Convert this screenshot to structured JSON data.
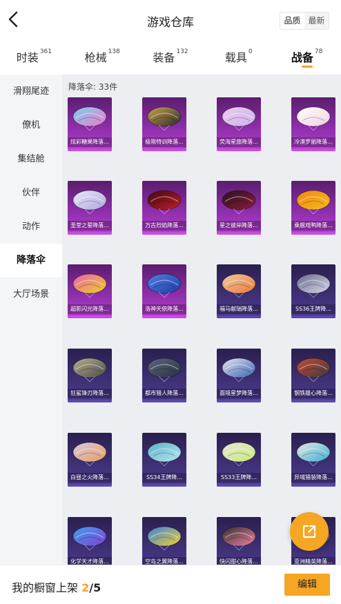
{
  "header": {
    "title": "游戏仓库",
    "sort_options": [
      "品质",
      "最新"
    ],
    "active_sort": 0
  },
  "tabs": [
    {
      "label": "时装",
      "count": "361"
    },
    {
      "label": "枪械",
      "count": "138"
    },
    {
      "label": "装备",
      "count": "132"
    },
    {
      "label": "载具",
      "count": "0"
    },
    {
      "label": "战备",
      "count": "78"
    }
  ],
  "active_tab": 4,
  "sidebar": {
    "items": [
      {
        "label": "滑翔尾迹"
      },
      {
        "label": "僚机"
      },
      {
        "label": "集结舱"
      },
      {
        "label": "伙伴"
      },
      {
        "label": "动作"
      },
      {
        "label": "降落伞"
      },
      {
        "label": "大厅场景"
      }
    ],
    "active_index": 5
  },
  "content": {
    "count_label": "降落伞: 33件",
    "items": [
      {
        "name": "炫彩糖果降落...",
        "tier": "purple",
        "icon": "parachute-icon",
        "colors": [
          "#f07ac8",
          "#7ad0f0"
        ]
      },
      {
        "name": "极限特训降落...",
        "tier": "purple",
        "icon": "parachute-icon",
        "colors": [
          "#2a2a2a",
          "#c9a24a"
        ]
      },
      {
        "name": "荧海星旅降落...",
        "tier": "purple",
        "icon": "parachute-icon",
        "colors": [
          "#c8b6f0",
          "#f0c8e8"
        ]
      },
      {
        "name": "冷漠罗丽降落...",
        "tier": "purple",
        "icon": "parachute-icon",
        "colors": [
          "#f0d0e0",
          "#ffffff"
        ]
      },
      {
        "name": "圣堂之誓降落...",
        "tier": "purple",
        "icon": "parachute-icon",
        "colors": [
          "#b0a8e0",
          "#e8e8f8"
        ]
      },
      {
        "name": "万古烈焰降落...",
        "tier": "purple",
        "icon": "parachute-icon",
        "colors": [
          "#c81e28",
          "#3a0a10"
        ]
      },
      {
        "name": "星之彼岸降落...",
        "tier": "purple",
        "icon": "parachute-icon",
        "colors": [
          "#8a1e3a",
          "#2a1020"
        ]
      },
      {
        "name": "乘舰戏鸭降落...",
        "tier": "purple",
        "icon": "parachute-icon",
        "colors": [
          "#f5b820",
          "#f08a10"
        ]
      },
      {
        "name": "超影闪光降落...",
        "tier": "purple",
        "icon": "parachute-icon",
        "colors": [
          "#f0d020",
          "#e860b0"
        ]
      },
      {
        "name": "洛神天依降落...",
        "tier": "purple",
        "icon": "parachute-icon",
        "colors": [
          "#1e3aa8",
          "#5080e0"
        ]
      },
      {
        "name": "福马献瑞降落...",
        "tier": "blue",
        "icon": "parachute-icon",
        "colors": [
          "#e87a3a",
          "#f0c8a0"
        ]
      },
      {
        "name": "SS36王牌降...",
        "tier": "blue",
        "icon": "parachute-icon",
        "colors": [
          "#d8d8e8",
          "#6a6a90"
        ]
      },
      {
        "name": "狂鲨锋刃降落...",
        "tier": "blue",
        "icon": "parachute-icon",
        "colors": [
          "#4a4a48",
          "#b8b090"
        ]
      },
      {
        "name": "都市猎人降落...",
        "tier": "blue",
        "icon": "parachute-icon",
        "colors": [
          "#2a3040",
          "#5a6880"
        ]
      },
      {
        "name": "面境星梦降落...",
        "tier": "blue",
        "icon": "parachute-icon",
        "colors": [
          "#3a60b0",
          "#e8e8f0"
        ]
      },
      {
        "name": "钢铁雄心降落...",
        "tier": "blue",
        "icon": "parachute-icon",
        "colors": [
          "#3a3a40",
          "#c84a30"
        ]
      },
      {
        "name": "白昼之火降落...",
        "tier": "blue",
        "icon": "parachute-icon",
        "colors": [
          "#e8a060",
          "#d8c8e0"
        ]
      },
      {
        "name": "SS34王牌降...",
        "tier": "blue",
        "icon": "parachute-icon",
        "colors": [
          "#b8e8f0",
          "#5ab0c8"
        ]
      },
      {
        "name": "SS33王牌降...",
        "tier": "blue",
        "icon": "parachute-icon",
        "colors": [
          "#c8e880",
          "#e8e8d0"
        ]
      },
      {
        "name": "异域猎装降落...",
        "tier": "blue",
        "icon": "parachute-icon",
        "colors": [
          "#3ab0d0",
          "#e8e8e8"
        ]
      },
      {
        "name": "化学天才降落...",
        "tier": "blue",
        "icon": "parachute-icon",
        "colors": [
          "#8040d0",
          "#40a0f0"
        ]
      },
      {
        "name": "空岛之翼降落...",
        "tier": "blue",
        "icon": "parachute-icon",
        "colors": [
          "#f0d030",
          "#3a80e0"
        ]
      },
      {
        "name": "快闪甜心降落...",
        "tier": "blue",
        "icon": "parachute-icon",
        "colors": [
          "#f080a0",
          "#303030"
        ]
      },
      {
        "name": "亚洲精英降落...",
        "tier": "blue",
        "icon": "parachute-icon",
        "colors": [
          "#3a3a3a",
          "#c8c8c8"
        ]
      }
    ]
  },
  "fab": {
    "icon": "share-icon",
    "color": "#f5a623"
  },
  "footer": {
    "prefix": "我的橱窗上架 ",
    "current": "2",
    "max": "/5",
    "edit_label": "编辑"
  },
  "colors": {
    "accent": "#f5a623",
    "purple_tier": "#b53fd0",
    "blue_tier": "#4e3b90"
  }
}
